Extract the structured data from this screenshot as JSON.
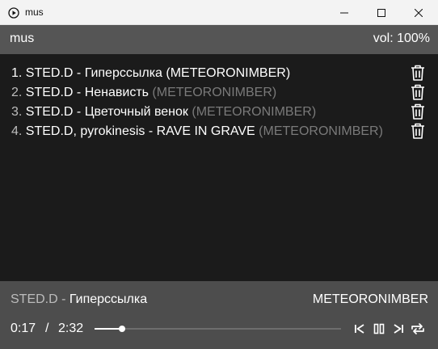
{
  "window": {
    "title": "mus",
    "icon": "play-circle-icon",
    "buttons": [
      "minimize-icon",
      "maximize-icon",
      "close-icon"
    ]
  },
  "header": {
    "app_name": "mus",
    "volume_label": "vol: 100%"
  },
  "playlist": {
    "tracks": [
      {
        "number": "1. ",
        "title": "STED.D - Гиперссылка",
        "album": " (METEORONIMBER)",
        "active": true
      },
      {
        "number": "2. ",
        "title": "STED.D - Ненависть",
        "album": " (METEORONIMBER)",
        "active": false
      },
      {
        "number": "3. ",
        "title": "STED.D - Цветочный венок",
        "album": " (METEORONIMBER)",
        "active": false
      },
      {
        "number": "4. ",
        "title": "STED.D, pyrokinesis - RAVE IN GRAVE",
        "album": " (METEORONIMBER)",
        "active": false
      }
    ],
    "delete_icon": "trash-icon"
  },
  "player": {
    "artist": "STED.D",
    "separator": " - ",
    "title": "Гиперссылка",
    "album": "METEORONIMBER",
    "current_time": "0:17",
    "time_separator": "/",
    "total_time": "2:32",
    "progress": 0.11,
    "controls": [
      "previous-icon",
      "pause-icon",
      "next-icon",
      "repeat-icon"
    ]
  },
  "colors": {
    "titlebar": "#f3f3f3",
    "header": "#555555",
    "list_bg": "#1b1b1b",
    "player_bg": "#4d4d4d",
    "muted_text": "#7a7a7a"
  }
}
